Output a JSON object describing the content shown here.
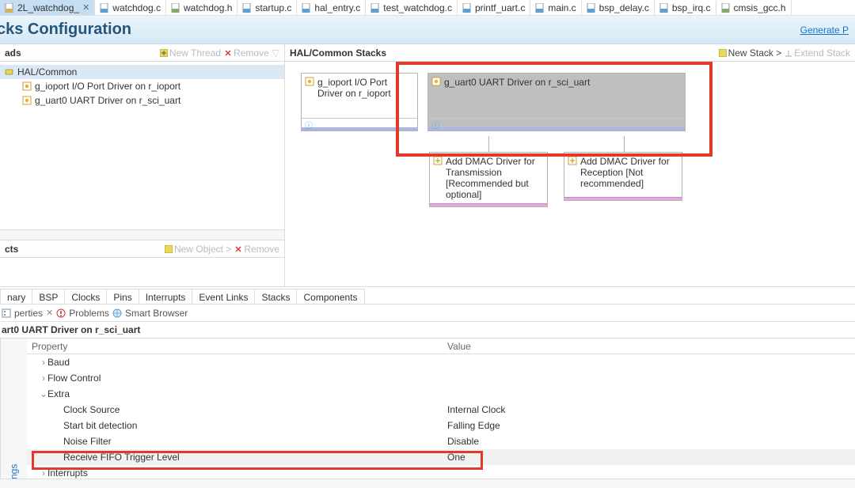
{
  "fileTabs": [
    {
      "name": "2L_watchdog_",
      "active": true,
      "icon": "cfg",
      "closeable": true
    },
    {
      "name": "watchdog.c",
      "active": false,
      "icon": "c",
      "closeable": false
    },
    {
      "name": "watchdog.h",
      "active": false,
      "icon": "h",
      "closeable": false
    },
    {
      "name": "startup.c",
      "active": false,
      "icon": "c",
      "closeable": false
    },
    {
      "name": "hal_entry.c",
      "active": false,
      "icon": "c",
      "closeable": false
    },
    {
      "name": "test_watchdog.c",
      "active": false,
      "icon": "c",
      "closeable": false
    },
    {
      "name": "printf_uart.c",
      "active": false,
      "icon": "c",
      "closeable": false
    },
    {
      "name": "main.c",
      "active": false,
      "icon": "c",
      "closeable": false
    },
    {
      "name": "bsp_delay.c",
      "active": false,
      "icon": "c",
      "closeable": false
    },
    {
      "name": "bsp_irq.c",
      "active": false,
      "icon": "c",
      "closeable": false
    },
    {
      "name": "cmsis_gcc.h",
      "active": false,
      "icon": "h",
      "closeable": false
    }
  ],
  "banner": {
    "title": "cks Configuration",
    "generate": "Generate P"
  },
  "threadsPane": {
    "title": "ads",
    "actions": {
      "newThread": "New Thread",
      "remove": "Remove"
    },
    "tree": {
      "root": "HAL/Common",
      "items": [
        "g_ioport I/O Port Driver on r_ioport",
        "g_uart0 UART Driver on r_sci_uart"
      ]
    }
  },
  "objectsPane": {
    "title": "cts",
    "actions": {
      "newObject": "New Object >",
      "remove": "Remove"
    }
  },
  "halStacks": {
    "title": "HAL/Common Stacks",
    "actions": {
      "newStack": "New Stack >",
      "extend": "Extend Stack"
    },
    "ioport": "g_ioport I/O Port Driver on r_ioport",
    "uart": "g_uart0 UART Driver on r_sci_uart",
    "dmacTx": "Add DMAC Driver for Transmission [Recommended but optional]",
    "dmacRx": "Add DMAC Driver for Reception [Not recommended]"
  },
  "subtabs": [
    "nary",
    "BSP",
    "Clocks",
    "Pins",
    "Interrupts",
    "Event Links",
    "Stacks",
    "Components"
  ],
  "subtabActive": "Stacks",
  "viewTabs": {
    "properties": "perties",
    "problems": "Problems",
    "smart": "Smart Browser"
  },
  "propertiesHeader": "art0 UART Driver on r_sci_uart",
  "sideTab": "ngs",
  "propGrid": {
    "headers": {
      "property": "Property",
      "value": "Value"
    },
    "rows": [
      {
        "kind": "branch-collapsed",
        "label": "Baud",
        "value": ""
      },
      {
        "kind": "branch-collapsed",
        "label": "Flow Control",
        "value": ""
      },
      {
        "kind": "branch-expanded",
        "label": "Extra",
        "value": ""
      },
      {
        "kind": "leaf",
        "label": "Clock Source",
        "value": "Internal Clock"
      },
      {
        "kind": "leaf",
        "label": "Start bit detection",
        "value": "Falling Edge"
      },
      {
        "kind": "leaf",
        "label": "Noise Filter",
        "value": "Disable"
      },
      {
        "kind": "leaf-selected",
        "label": "Receive FIFO Trigger Level",
        "value": "One"
      },
      {
        "kind": "branch-collapsed",
        "label": "Interrupts",
        "value": ""
      }
    ]
  }
}
